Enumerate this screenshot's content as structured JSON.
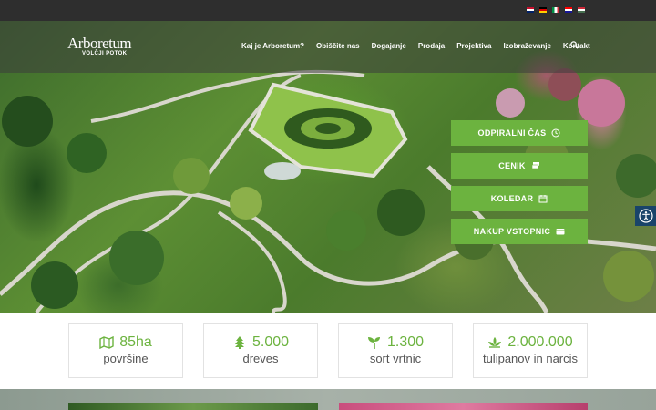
{
  "top_bar": {
    "languages": [
      "English",
      "Deutsch",
      "Italiano",
      "Hrvatski",
      "Magyar"
    ]
  },
  "logo": {
    "line1": "Arboretum",
    "line2": "VOLČJI POTOK"
  },
  "nav": {
    "items": [
      "Kaj je Arboretum?",
      "Obiščite nas",
      "Dogajanje",
      "Prodaja",
      "Projektiva",
      "Izobraževanje",
      "Kontakt"
    ],
    "search_icon": "search-icon"
  },
  "cta_buttons": [
    {
      "label": "ODPIRALNI ČAS",
      "icon": "clock-icon"
    },
    {
      "label": "CENIK",
      "icon": "money-icon"
    },
    {
      "label": "KOLEDAR",
      "icon": "calendar-icon"
    },
    {
      "label": "NAKUP VSTOPNIC",
      "icon": "credit-card-icon"
    }
  ],
  "accessibility": {
    "icon": "accessibility-icon"
  },
  "stats": [
    {
      "value": "85ha",
      "label": "površine",
      "icon": "map-icon"
    },
    {
      "value": "5.000",
      "label": "dreves",
      "icon": "tree-icon"
    },
    {
      "value": "1.300",
      "label": "sort vrtnic",
      "icon": "seedling-icon"
    },
    {
      "value": "2.000.000",
      "label": "tulipanov in narcis",
      "icon": "lotus-icon"
    }
  ],
  "colors": {
    "accent": "#6cb33f",
    "topbar": "#2e2e2e",
    "accessibility": "#19446a"
  }
}
